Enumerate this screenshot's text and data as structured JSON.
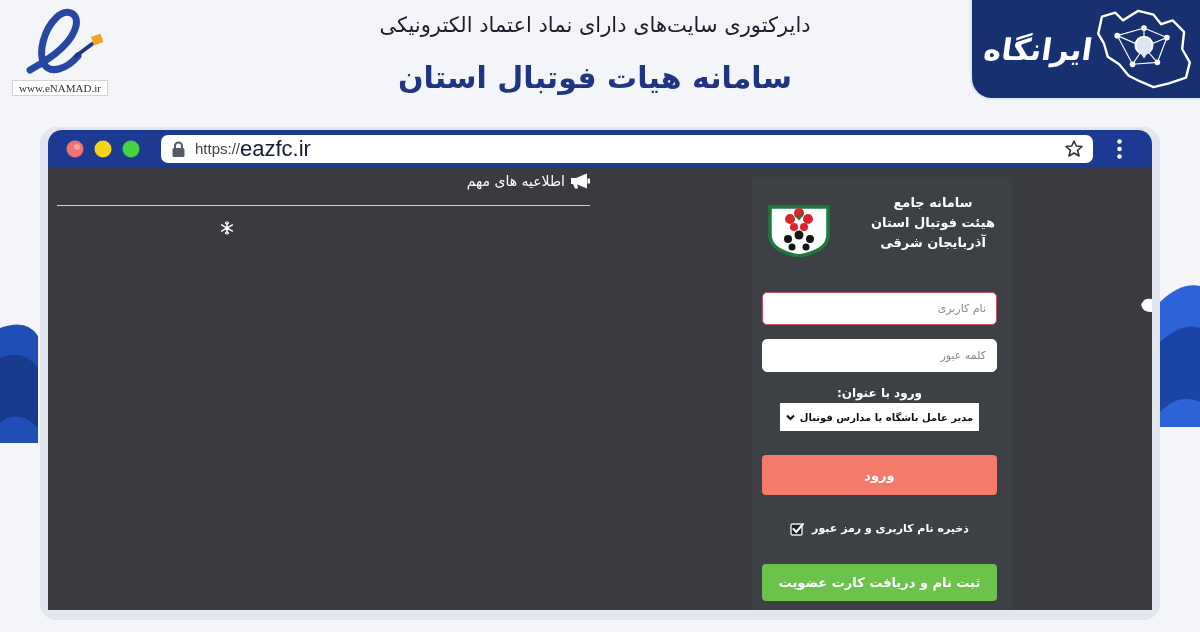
{
  "header": {
    "enamad_logo": {
      "caption": "www.eNAMAD.ir"
    },
    "subtitle": "دایرکتوری سایت‌های دارای نماد اعتماد الکترونیکی",
    "title": "سامانه هیات فوتبال استان",
    "brand_logo": {
      "text": "ایرانگاه"
    }
  },
  "browser": {
    "address_bar": {
      "scheme": "https://",
      "host": "eazfc.ir"
    },
    "announcements": {
      "heading": "اطلاعیه های مهم"
    },
    "login": {
      "title_lines": [
        "سامانه جامع",
        "هیئت فوتبال استان",
        "آذربایجان شرقی"
      ],
      "username_field": {
        "placeholder": "نام کاربری",
        "focused": true
      },
      "password_field": {
        "placeholder": "کلمه عبور",
        "focused": false
      },
      "role_label": "ورود با عنوان:",
      "role_select": {
        "value": "مدیر عامل باشگاه یا مدارس فوتبال"
      },
      "submit_button": {
        "label": "ورود"
      },
      "remember": {
        "label": "ذخیره نام کاربری و رمز عبور",
        "checked": true
      },
      "register_button": {
        "label": "ثبت نام و دریافت کارت عضویت"
      }
    }
  }
}
